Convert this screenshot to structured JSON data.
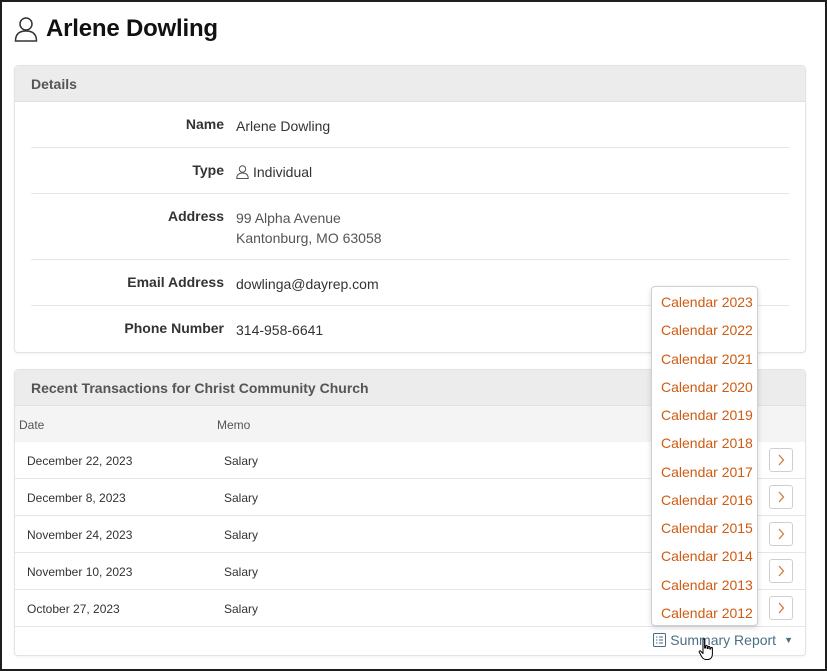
{
  "header": {
    "title": "Arlene Dowling"
  },
  "details": {
    "heading": "Details",
    "rows": [
      {
        "label": "Name",
        "value": "Arlene Dowling"
      },
      {
        "label": "Type",
        "value": "Individual"
      },
      {
        "label": "Address",
        "line1": "99 Alpha Avenue",
        "line2": "Kantonburg, MO 63058"
      },
      {
        "label": "Email Address",
        "value": "dowlinga@dayrep.com"
      },
      {
        "label": "Phone Number",
        "value": "314-958-6641"
      }
    ]
  },
  "transactions": {
    "heading": "Recent Transactions for Christ Community Church",
    "columns": {
      "date": "Date",
      "memo": "Memo"
    },
    "rows": [
      {
        "date": "December 22, 2023",
        "memo": "Salary"
      },
      {
        "date": "December 8, 2023",
        "memo": "Salary"
      },
      {
        "date": "November 24, 2023",
        "memo": "Salary"
      },
      {
        "date": "November 10, 2023",
        "memo": "Salary"
      },
      {
        "date": "October 27, 2023",
        "memo": "Salary"
      }
    ],
    "summary_label": "Summary Report"
  },
  "summary_menu": {
    "items": [
      "Calendar 2023",
      "Calendar 2022",
      "Calendar 2021",
      "Calendar 2020",
      "Calendar 2019",
      "Calendar 2018",
      "Calendar 2017",
      "Calendar 2016",
      "Calendar 2015",
      "Calendar 2014",
      "Calendar 2013",
      "Calendar 2012"
    ]
  },
  "icons": {
    "person": "person-icon",
    "row_action": "chevron-right-icon",
    "summary": "list-icon",
    "cursor": "hand-pointer-icon"
  },
  "colors": {
    "menu_link": "#cf5b12",
    "summary_link": "#4a6f82",
    "panel_header_bg": "#ececec"
  }
}
